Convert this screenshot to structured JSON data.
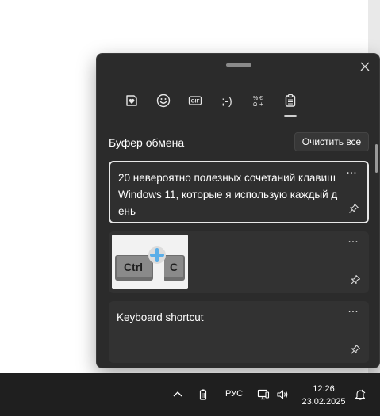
{
  "panel": {
    "tabs": [
      {
        "name": "stickers",
        "icon": "heart-sticker-icon"
      },
      {
        "name": "emoji",
        "icon": "smiley-icon"
      },
      {
        "name": "gif",
        "icon": "gif-icon",
        "label": "GIF"
      },
      {
        "name": "kaomoji",
        "icon": "kaomoji-icon",
        "label": ";-)"
      },
      {
        "name": "symbols",
        "icon": "symbols-icon"
      },
      {
        "name": "clipboard",
        "icon": "clipboard-icon",
        "active": true
      }
    ],
    "section_title": "Буфер обмена",
    "clear_label": "Очистить все",
    "items": [
      {
        "type": "text",
        "text": "20 невероятно полезных сочетаний клавиш Windows 11, которые я использую каждый день",
        "selected": true
      },
      {
        "type": "image",
        "image_label_left": "Ctrl",
        "image_label_right": "C"
      },
      {
        "type": "text",
        "text": "Keyboard shortcut"
      }
    ],
    "more_label": "···"
  },
  "taskbar": {
    "language": "РУС",
    "time": "12:26",
    "date": "23.02.2025"
  },
  "colors": {
    "panel_bg": "#2b2b2b",
    "item_bg": "#323232",
    "taskbar_bg": "#1f1f1f",
    "accent_plus": "#5aaee8"
  }
}
